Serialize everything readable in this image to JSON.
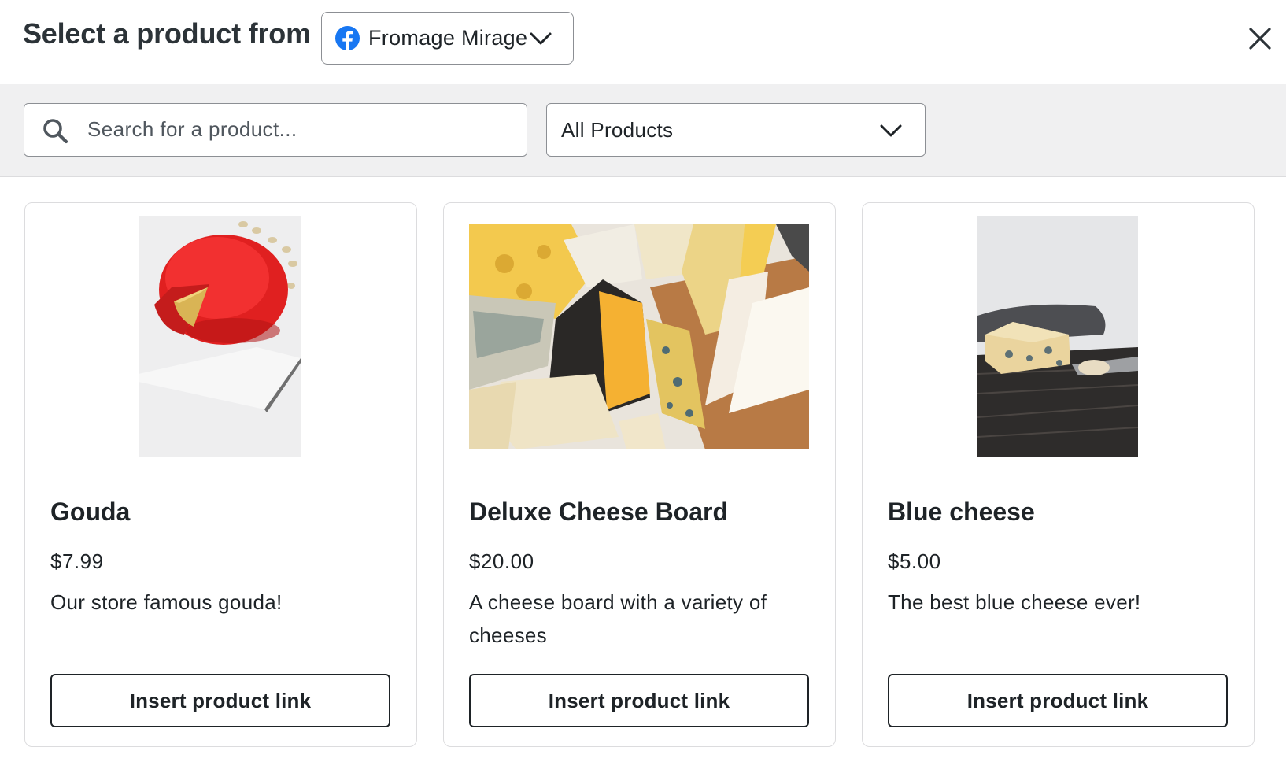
{
  "header": {
    "title": "Select a product from",
    "store_selector": {
      "label": "Fromage Mirage",
      "icon": "facebook-icon",
      "icon_color": "#1877f2"
    },
    "close_icon": "close-icon"
  },
  "filters": {
    "search_placeholder": "Search for a product...",
    "search_value": "",
    "category_selected": "All Products"
  },
  "products": [
    {
      "name": "Gouda",
      "price": "$7.99",
      "description": "Our store famous gouda!",
      "button_label": "Insert product link",
      "image": "gouda-photo"
    },
    {
      "name": "Deluxe Cheese Board",
      "price": "$20.00",
      "description": "A cheese board with a variety of cheeses",
      "button_label": "Insert product link",
      "image": "cheese-board-photo"
    },
    {
      "name": "Blue cheese",
      "price": "$5.00",
      "description": "The best blue cheese ever!",
      "button_label": "Insert product link",
      "image": "blue-cheese-photo"
    }
  ]
}
